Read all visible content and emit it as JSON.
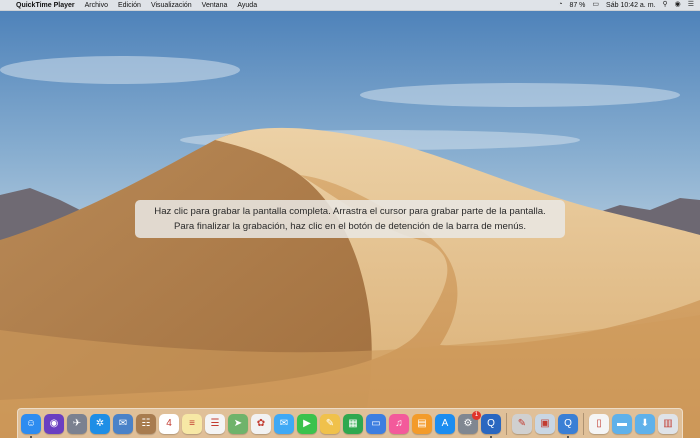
{
  "menubar": {
    "app_name": "QuickTime Player",
    "menus": [
      "Archivo",
      "Edición",
      "Visualización",
      "Ventana",
      "Ayuda"
    ],
    "battery": "87 %",
    "clock": "Sáb 10:42 a. m."
  },
  "overlay": {
    "line1": "Haz clic para grabar la pantalla completa. Arrastra el cursor para grabar parte de la pantalla.",
    "line2": "Para finalizar la grabación, haz clic en el botón de detención de la barra de menús."
  },
  "dock": {
    "items": [
      {
        "name": "finder",
        "icon": "finder-icon",
        "color": "#2d8cf0",
        "glyph": "☺"
      },
      {
        "name": "siri",
        "icon": "siri-icon",
        "color": "#6a3fc1",
        "glyph": "◉"
      },
      {
        "name": "launchpad",
        "icon": "launchpad-icon",
        "color": "#7b8190",
        "glyph": "✈"
      },
      {
        "name": "safari",
        "icon": "safari-icon",
        "color": "#1e8ee6",
        "glyph": "✲"
      },
      {
        "name": "mail",
        "icon": "mail-icon",
        "color": "#4a82c8",
        "glyph": "✉"
      },
      {
        "name": "contacts",
        "icon": "contacts-icon",
        "color": "#a87c4f",
        "glyph": "☷"
      },
      {
        "name": "calendar",
        "icon": "calendar-icon",
        "color": "#ffffff",
        "glyph": "4"
      },
      {
        "name": "notes",
        "icon": "notes-icon",
        "color": "#f7e8a5",
        "glyph": "≡"
      },
      {
        "name": "reminders",
        "icon": "reminders-icon",
        "color": "#f4f4f4",
        "glyph": "☰"
      },
      {
        "name": "maps",
        "icon": "maps-icon",
        "color": "#6fb36b",
        "glyph": "➤"
      },
      {
        "name": "photos",
        "icon": "photos-icon",
        "color": "#f2f2f2",
        "glyph": "✿"
      },
      {
        "name": "messages",
        "icon": "messages-icon",
        "color": "#3fa9f5",
        "glyph": "✉"
      },
      {
        "name": "facetime",
        "icon": "facetime-icon",
        "color": "#3bc24d",
        "glyph": "▶"
      },
      {
        "name": "pages",
        "icon": "pages-icon",
        "color": "#f0c14b",
        "glyph": "✎"
      },
      {
        "name": "numbers",
        "icon": "numbers-icon",
        "color": "#2fa84f",
        "glyph": "▦"
      },
      {
        "name": "keynote",
        "icon": "keynote-icon",
        "color": "#3d7ee0",
        "glyph": "▭"
      },
      {
        "name": "itunes",
        "icon": "itunes-icon",
        "color": "#f35a9b",
        "glyph": "♫"
      },
      {
        "name": "books",
        "icon": "books-icon",
        "color": "#f39b2a",
        "glyph": "▤"
      },
      {
        "name": "app-store",
        "icon": "app-store-icon",
        "color": "#1c8df0",
        "glyph": "A"
      },
      {
        "name": "system-preferences",
        "icon": "system-preferences-icon",
        "color": "#808791",
        "glyph": "⚙",
        "badge": "1"
      },
      {
        "name": "quicktime",
        "icon": "quicktime-icon",
        "color": "#2a67c0",
        "glyph": "Q"
      },
      {
        "name": "separator"
      },
      {
        "name": "script-editor",
        "icon": "script-editor-icon",
        "color": "#d0d0d0",
        "glyph": "✎"
      },
      {
        "name": "preview",
        "icon": "preview-icon",
        "color": "#c9d6e3",
        "glyph": "▣"
      },
      {
        "name": "quicktime-2",
        "icon": "quicktime-icon",
        "color": "#3a7fd5",
        "glyph": "Q"
      },
      {
        "name": "separator"
      },
      {
        "name": "document",
        "icon": "document-icon",
        "color": "#f5f5f5",
        "glyph": "▯"
      },
      {
        "name": "folder",
        "icon": "folder-icon",
        "color": "#5fb1ea",
        "glyph": "▬"
      },
      {
        "name": "downloads",
        "icon": "downloads-icon",
        "color": "#5fb1ea",
        "glyph": "⬇"
      },
      {
        "name": "trash",
        "icon": "trash-icon",
        "color": "#dfe3e8",
        "glyph": "▥"
      }
    ]
  }
}
